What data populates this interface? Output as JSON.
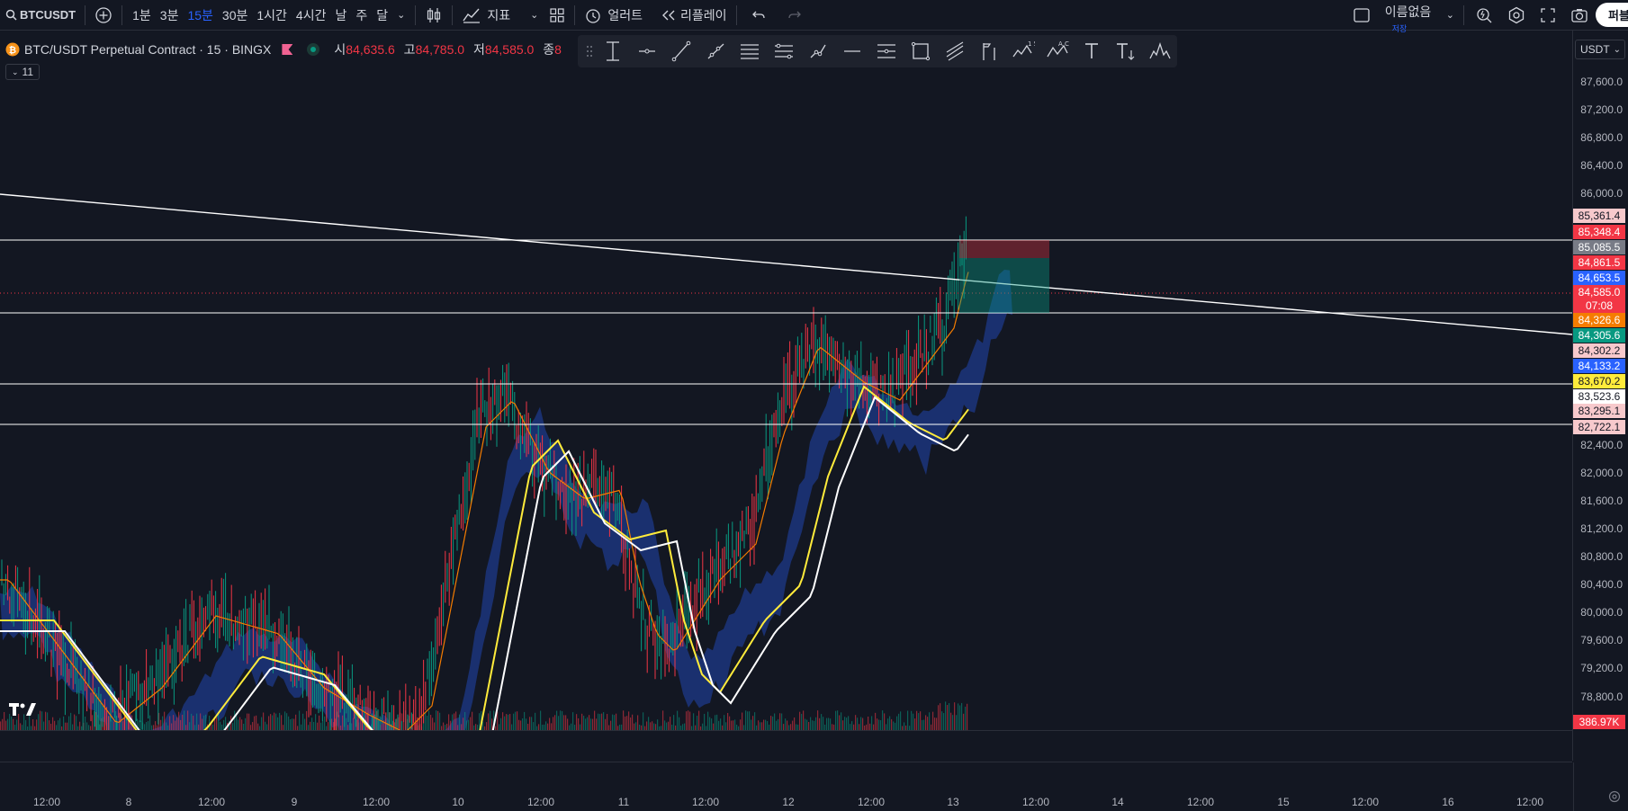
{
  "toolbar": {
    "symbol": "BTCUSDT",
    "intervals": [
      "1분",
      "3분",
      "15분",
      "30분",
      "1시간",
      "4시간",
      "날",
      "주",
      "달"
    ],
    "active_interval": "15분",
    "indicators_label": "지표",
    "alert_label": "얼러트",
    "replay_label": "리플레이",
    "layout_name": "이름없음",
    "save_status": "저장",
    "publish_label": "퍼블"
  },
  "legend": {
    "title": "BTC/USDT Perpetual Contract · 15 · BINGX",
    "open_label": "시",
    "open": "84,635.6",
    "high_label": "고",
    "high": "84,785.0",
    "low_label": "저",
    "low": "84,585.0",
    "close_label": "종",
    "close": "8",
    "indicator_count": "11"
  },
  "currency": "USDT",
  "price_ticks": [
    "87,600.0",
    "87,200.0",
    "86,800.0",
    "86,400.0",
    "86,000.0",
    "82,400.0",
    "82,000.0",
    "81,600.0",
    "81,200.0",
    "80,800.0",
    "80,400.0",
    "80,000.0",
    "79,600.0",
    "79,200.0",
    "78,800.0"
  ],
  "price_labels": [
    {
      "text": "85,361.4",
      "bg": "#f7c9cc",
      "fg": "#131722"
    },
    {
      "text": "85,348.4",
      "bg": "#f23645",
      "fg": "#ffffff"
    },
    {
      "text": "85,085.5",
      "bg": "#787b86",
      "fg": "#ffffff"
    },
    {
      "text": "84,861.5",
      "bg": "#f23645",
      "fg": "#ffffff"
    },
    {
      "text": "84,653.5",
      "bg": "#2962ff",
      "fg": "#ffffff"
    },
    {
      "text": "84,585.0",
      "bg": "#f23645",
      "fg": "#ffffff"
    },
    {
      "text": "07:08",
      "bg": "#f23645",
      "fg": "#ffffff"
    },
    {
      "text": "84,326.6",
      "bg": "#f57c00",
      "fg": "#ffffff"
    },
    {
      "text": "84,305.6",
      "bg": "#089981",
      "fg": "#ffffff"
    },
    {
      "text": "84,302.2",
      "bg": "#f7c9cc",
      "fg": "#131722"
    },
    {
      "text": "84,133.2",
      "bg": "#2962ff",
      "fg": "#ffffff"
    },
    {
      "text": "83,670.2",
      "bg": "#ffeb3b",
      "fg": "#131722"
    },
    {
      "text": "83,523.6",
      "bg": "#ffffff",
      "fg": "#131722"
    },
    {
      "text": "83,295.1",
      "bg": "#f7c9cc",
      "fg": "#131722"
    },
    {
      "text": "82,722.1",
      "bg": "#f7c9cc",
      "fg": "#131722"
    },
    {
      "text": "386.97K",
      "bg": "#f23645",
      "fg": "#ffffff"
    }
  ],
  "time_ticks": [
    "12:00",
    "8",
    "12:00",
    "9",
    "12:00",
    "10",
    "12:00",
    "11",
    "12:00",
    "12",
    "12:00",
    "13",
    "12:00",
    "14",
    "12:00",
    "15",
    "12:00",
    "16",
    "12:00"
  ],
  "colors": {
    "bg": "#131722",
    "up": "#089981",
    "down": "#f23645",
    "ma_orange": "#f57c00",
    "ma_yellow": "#ffeb3b",
    "ma_white": "#ffffff",
    "cloud": "#1e3a8a",
    "accent": "#2962ff"
  }
}
